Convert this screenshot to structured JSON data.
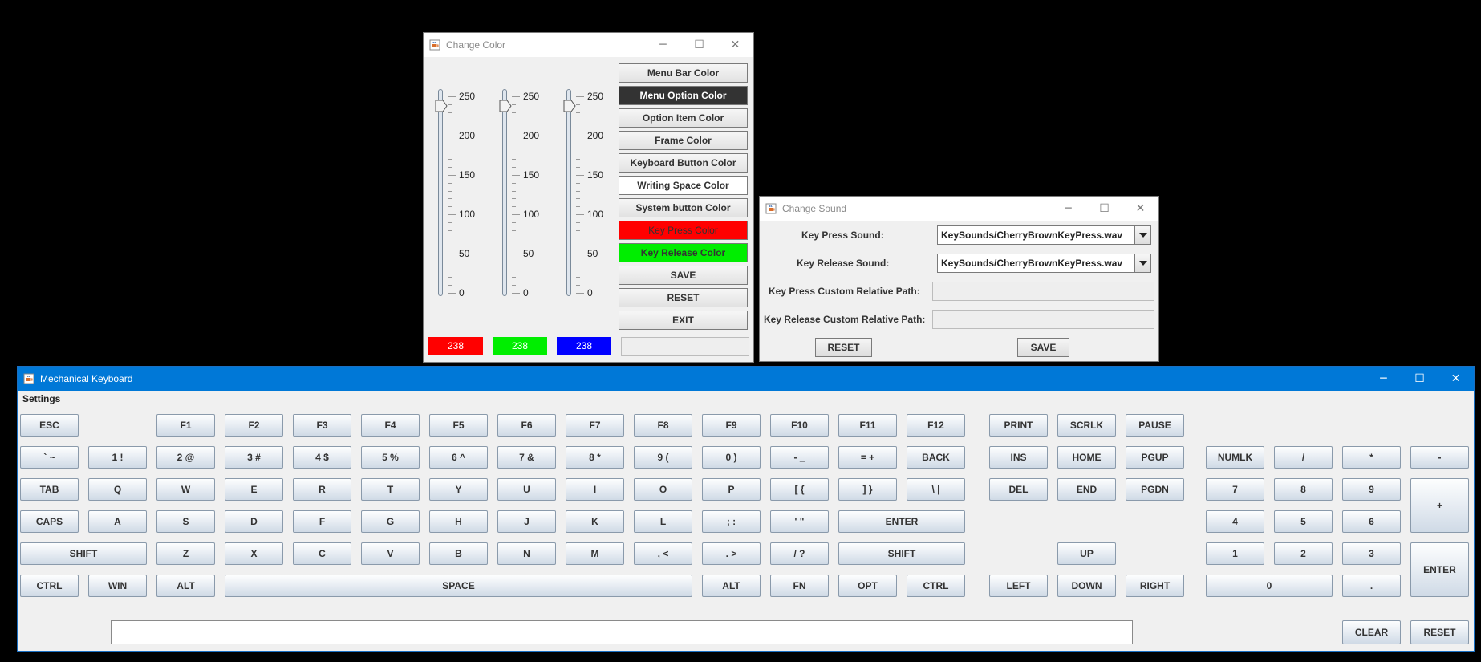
{
  "color_window": {
    "title": "Change Color",
    "title_icon": "java-cup-icon",
    "controls": [
      "minimize-icon",
      "maximize-icon",
      "close-icon"
    ],
    "slider_scale": [
      "250",
      "200",
      "150",
      "100",
      "50",
      "0"
    ],
    "sliders": [
      {
        "channel": "red",
        "value": 238,
        "display": "238",
        "color": "#ff0000"
      },
      {
        "channel": "green",
        "value": 238,
        "display": "238",
        "color": "#00ee00"
      },
      {
        "channel": "blue",
        "value": 238,
        "display": "238",
        "color": "#0000ff"
      }
    ],
    "buttons": [
      {
        "label": "Menu Bar Color",
        "bg": "",
        "fg": ""
      },
      {
        "label": "Menu Option Color",
        "bg": "#333333",
        "fg": "#ffffff"
      },
      {
        "label": "Option Item Color",
        "bg": "",
        "fg": ""
      },
      {
        "label": "Frame Color",
        "bg": "",
        "fg": ""
      },
      {
        "label": "Keyboard Button Color",
        "bg": "",
        "fg": ""
      },
      {
        "label": "Writing Space Color",
        "bg": "#ffffff",
        "fg": ""
      },
      {
        "label": "System button Color",
        "bg": "",
        "fg": ""
      },
      {
        "label": "Key Press Color",
        "bg": "#ff0000",
        "fg": "#333333"
      },
      {
        "label": "Key Release Color",
        "bg": "#00ee00",
        "fg": "#333333"
      },
      {
        "label": "SAVE",
        "bg": "",
        "fg": ""
      },
      {
        "label": "RESET",
        "bg": "",
        "fg": ""
      },
      {
        "label": "EXIT",
        "bg": "",
        "fg": ""
      }
    ],
    "preview_value": ""
  },
  "sound_window": {
    "title": "Change Sound",
    "title_icon": "java-cup-icon",
    "controls": [
      "minimize-icon",
      "maximize-icon",
      "close-icon"
    ],
    "key_press_label": "Key Press Sound:",
    "key_press_value": "KeySounds/CherryBrownKeyPress.wav",
    "key_release_label": "Key Release Sound:",
    "key_release_value": "KeySounds/CherryBrownKeyPress.wav",
    "press_path_label": "Key Press Custom Relative Path:",
    "press_path_value": "",
    "release_path_label": "Key Release Custom Relative Path:",
    "release_path_value": "",
    "reset_label": "RESET",
    "save_label": "SAVE"
  },
  "keyboard_window": {
    "title": "Mechanical Keyboard",
    "title_icon": "java-cup-icon",
    "controls": [
      "minimize-icon",
      "maximize-icon",
      "close-icon"
    ],
    "menu": [
      "Settings"
    ],
    "keys": [
      {
        "label": "ESC",
        "row": 0,
        "col": 0
      },
      {
        "label": "F1",
        "row": 0,
        "col": 2
      },
      {
        "label": "F2",
        "row": 0,
        "col": 3
      },
      {
        "label": "F3",
        "row": 0,
        "col": 4
      },
      {
        "label": "F4",
        "row": 0,
        "col": 5
      },
      {
        "label": "F5",
        "row": 0,
        "col": 6
      },
      {
        "label": "F6",
        "row": 0,
        "col": 7
      },
      {
        "label": "F7",
        "row": 0,
        "col": 8
      },
      {
        "label": "F8",
        "row": 0,
        "col": 9
      },
      {
        "label": "F9",
        "row": 0,
        "col": 10
      },
      {
        "label": "F10",
        "row": 0,
        "col": 11
      },
      {
        "label": "F11",
        "row": 0,
        "col": 12
      },
      {
        "label": "F12",
        "row": 0,
        "col": 13
      },
      {
        "label": "PRINT",
        "row": 0,
        "col": 14
      },
      {
        "label": "SCRLK",
        "row": 0,
        "col": 15
      },
      {
        "label": "PAUSE",
        "row": 0,
        "col": 16
      },
      {
        "label": "` ~",
        "row": 1,
        "col": 0
      },
      {
        "label": "1 !",
        "row": 1,
        "col": 1
      },
      {
        "label": "2 @",
        "row": 1,
        "col": 2
      },
      {
        "label": "3 #",
        "row": 1,
        "col": 3
      },
      {
        "label": "4 $",
        "row": 1,
        "col": 4
      },
      {
        "label": "5 %",
        "row": 1,
        "col": 5
      },
      {
        "label": "6 ^",
        "row": 1,
        "col": 6
      },
      {
        "label": "7 &",
        "row": 1,
        "col": 7
      },
      {
        "label": "8 *",
        "row": 1,
        "col": 8
      },
      {
        "label": "9 (",
        "row": 1,
        "col": 9
      },
      {
        "label": "0 )",
        "row": 1,
        "col": 10
      },
      {
        "label": "- _",
        "row": 1,
        "col": 11
      },
      {
        "label": "= +",
        "row": 1,
        "col": 12
      },
      {
        "label": "BACK",
        "row": 1,
        "col": 13
      },
      {
        "label": "INS",
        "row": 1,
        "col": 14
      },
      {
        "label": "HOME",
        "row": 1,
        "col": 15
      },
      {
        "label": "PGUP",
        "row": 1,
        "col": 16
      },
      {
        "label": "NUMLK",
        "row": 1,
        "col": 17
      },
      {
        "label": "/",
        "row": 1,
        "col": 18
      },
      {
        "label": "*",
        "row": 1,
        "col": 19
      },
      {
        "label": "-",
        "row": 1,
        "col": 20
      },
      {
        "label": "TAB",
        "row": 2,
        "col": 0
      },
      {
        "label": "Q",
        "row": 2,
        "col": 1
      },
      {
        "label": "W",
        "row": 2,
        "col": 2
      },
      {
        "label": "E",
        "row": 2,
        "col": 3
      },
      {
        "label": "R",
        "row": 2,
        "col": 4
      },
      {
        "label": "T",
        "row": 2,
        "col": 5
      },
      {
        "label": "Y",
        "row": 2,
        "col": 6
      },
      {
        "label": "U",
        "row": 2,
        "col": 7
      },
      {
        "label": "I",
        "row": 2,
        "col": 8
      },
      {
        "label": "O",
        "row": 2,
        "col": 9
      },
      {
        "label": "P",
        "row": 2,
        "col": 10
      },
      {
        "label": "[ {",
        "row": 2,
        "col": 11
      },
      {
        "label": "] }",
        "row": 2,
        "col": 12
      },
      {
        "label": "\\ |",
        "row": 2,
        "col": 13
      },
      {
        "label": "DEL",
        "row": 2,
        "col": 14
      },
      {
        "label": "END",
        "row": 2,
        "col": 15
      },
      {
        "label": "PGDN",
        "row": 2,
        "col": 16
      },
      {
        "label": "7",
        "row": 2,
        "col": 17
      },
      {
        "label": "8",
        "row": 2,
        "col": 18
      },
      {
        "label": "9",
        "row": 2,
        "col": 19
      },
      {
        "label": "+",
        "row": 2,
        "col": 20,
        "rowspan": 2
      },
      {
        "label": "CAPS",
        "row": 3,
        "col": 0
      },
      {
        "label": "A",
        "row": 3,
        "col": 1
      },
      {
        "label": "S",
        "row": 3,
        "col": 2
      },
      {
        "label": "D",
        "row": 3,
        "col": 3
      },
      {
        "label": "F",
        "row": 3,
        "col": 4
      },
      {
        "label": "G",
        "row": 3,
        "col": 5
      },
      {
        "label": "H",
        "row": 3,
        "col": 6
      },
      {
        "label": "J",
        "row": 3,
        "col": 7
      },
      {
        "label": "K",
        "row": 3,
        "col": 8
      },
      {
        "label": "L",
        "row": 3,
        "col": 9
      },
      {
        "label": "; :",
        "row": 3,
        "col": 10
      },
      {
        "label": "' \"",
        "row": 3,
        "col": 11
      },
      {
        "label": "ENTER",
        "row": 3,
        "col": 12,
        "colspan": 2
      },
      {
        "label": "4",
        "row": 3,
        "col": 17
      },
      {
        "label": "5",
        "row": 3,
        "col": 18
      },
      {
        "label": "6",
        "row": 3,
        "col": 19
      },
      {
        "label": "SHIFT",
        "row": 4,
        "col": 0,
        "colspan": 2
      },
      {
        "label": "Z",
        "row": 4,
        "col": 2
      },
      {
        "label": "X",
        "row": 4,
        "col": 3
      },
      {
        "label": "C",
        "row": 4,
        "col": 4
      },
      {
        "label": "V",
        "row": 4,
        "col": 5
      },
      {
        "label": "B",
        "row": 4,
        "col": 6
      },
      {
        "label": "N",
        "row": 4,
        "col": 7
      },
      {
        "label": "M",
        "row": 4,
        "col": 8
      },
      {
        "label": ", <",
        "row": 4,
        "col": 9
      },
      {
        "label": ". >",
        "row": 4,
        "col": 10
      },
      {
        "label": "/ ?",
        "row": 4,
        "col": 11
      },
      {
        "label": "SHIFT",
        "row": 4,
        "col": 12,
        "colspan": 2
      },
      {
        "label": "UP",
        "row": 4,
        "col": 15
      },
      {
        "label": "1",
        "row": 4,
        "col": 17
      },
      {
        "label": "2",
        "row": 4,
        "col": 18
      },
      {
        "label": "3",
        "row": 4,
        "col": 19
      },
      {
        "label": "ENTER",
        "row": 4,
        "col": 20,
        "rowspan": 2
      },
      {
        "label": "CTRL",
        "row": 5,
        "col": 0
      },
      {
        "label": "WIN",
        "row": 5,
        "col": 1
      },
      {
        "label": "ALT",
        "row": 5,
        "col": 2
      },
      {
        "label": "SPACE",
        "row": 5,
        "col": 3,
        "colspan": 7
      },
      {
        "label": "ALT",
        "row": 5,
        "col": 10
      },
      {
        "label": "FN",
        "row": 5,
        "col": 11
      },
      {
        "label": "OPT",
        "row": 5,
        "col": 12
      },
      {
        "label": "CTRL",
        "row": 5,
        "col": 13
      },
      {
        "label": "LEFT",
        "row": 5,
        "col": 14
      },
      {
        "label": "DOWN",
        "row": 5,
        "col": 15
      },
      {
        "label": "RIGHT",
        "row": 5,
        "col": 16
      },
      {
        "label": "0",
        "row": 5,
        "col": 17,
        "colspan": 2
      },
      {
        "label": ".",
        "row": 5,
        "col": 19
      }
    ],
    "writing_value": "",
    "clear_label": "CLEAR",
    "reset_label": "RESET"
  }
}
